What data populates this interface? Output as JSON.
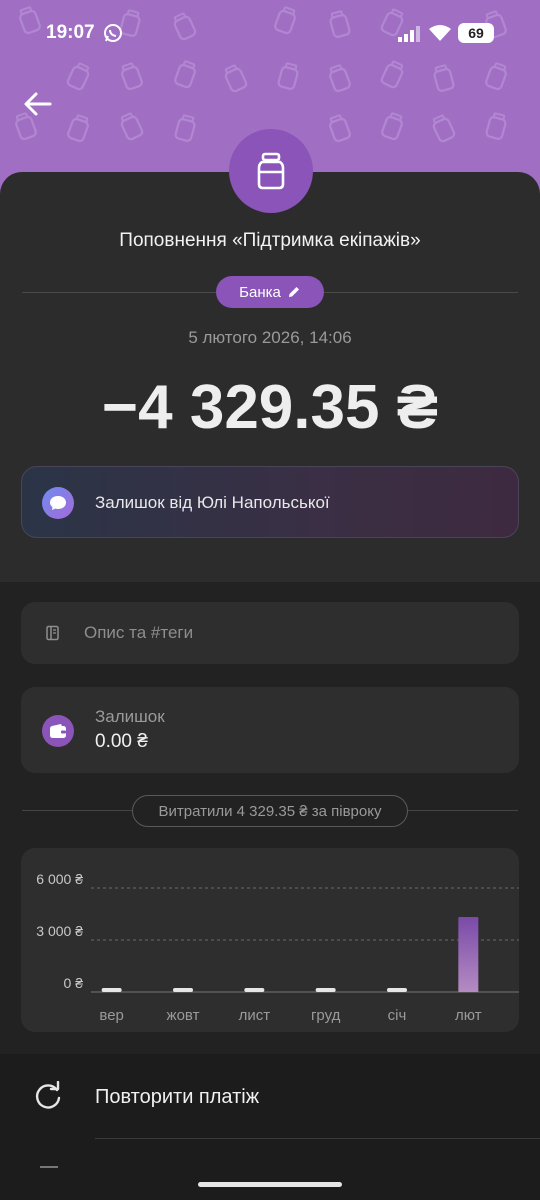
{
  "status_bar": {
    "time": "19:07",
    "battery": "69"
  },
  "header": {
    "title": "Поповнення «Підтримка екіпажів»"
  },
  "category": {
    "label": "Банка"
  },
  "transaction": {
    "date": "5 лютого 2026, 14:06",
    "amount": "−4 329.35 ₴"
  },
  "note": {
    "text": "Залишок від Юлі Напольської"
  },
  "description_field": {
    "placeholder": "Опис та #теги"
  },
  "balance": {
    "label": "Залишок",
    "value": "0.00 ₴"
  },
  "spent_summary": {
    "text": "Витратили 4 329.35 ₴ за півроку"
  },
  "chart_data": {
    "type": "bar",
    "categories": [
      "вер",
      "жовт",
      "лист",
      "груд",
      "січ",
      "лют"
    ],
    "values": [
      0,
      0,
      0,
      0,
      0,
      4329.35
    ],
    "ylim": [
      0,
      6000
    ],
    "y_ticks": [
      0,
      3000,
      6000
    ],
    "y_tick_labels": [
      "0 ₴",
      "3 000 ₴",
      "6 000 ₴"
    ],
    "grid": "dashed horizontal",
    "colors": {
      "bar_top": "#7a4aa8",
      "bar_bottom": "#b58bc2",
      "empty_bar": "#e6e6e6"
    }
  },
  "actions": {
    "repeat_label": "Повторити платіж"
  },
  "colors": {
    "accent": "#8a54b8",
    "header_bg": "#a06fc4",
    "card_bg": "#2c2c2c"
  },
  "icons": [
    "back-arrow-icon",
    "jar-icon",
    "pencil-icon",
    "message-icon",
    "notes-icon",
    "wallet-icon",
    "repeat-icon"
  ]
}
